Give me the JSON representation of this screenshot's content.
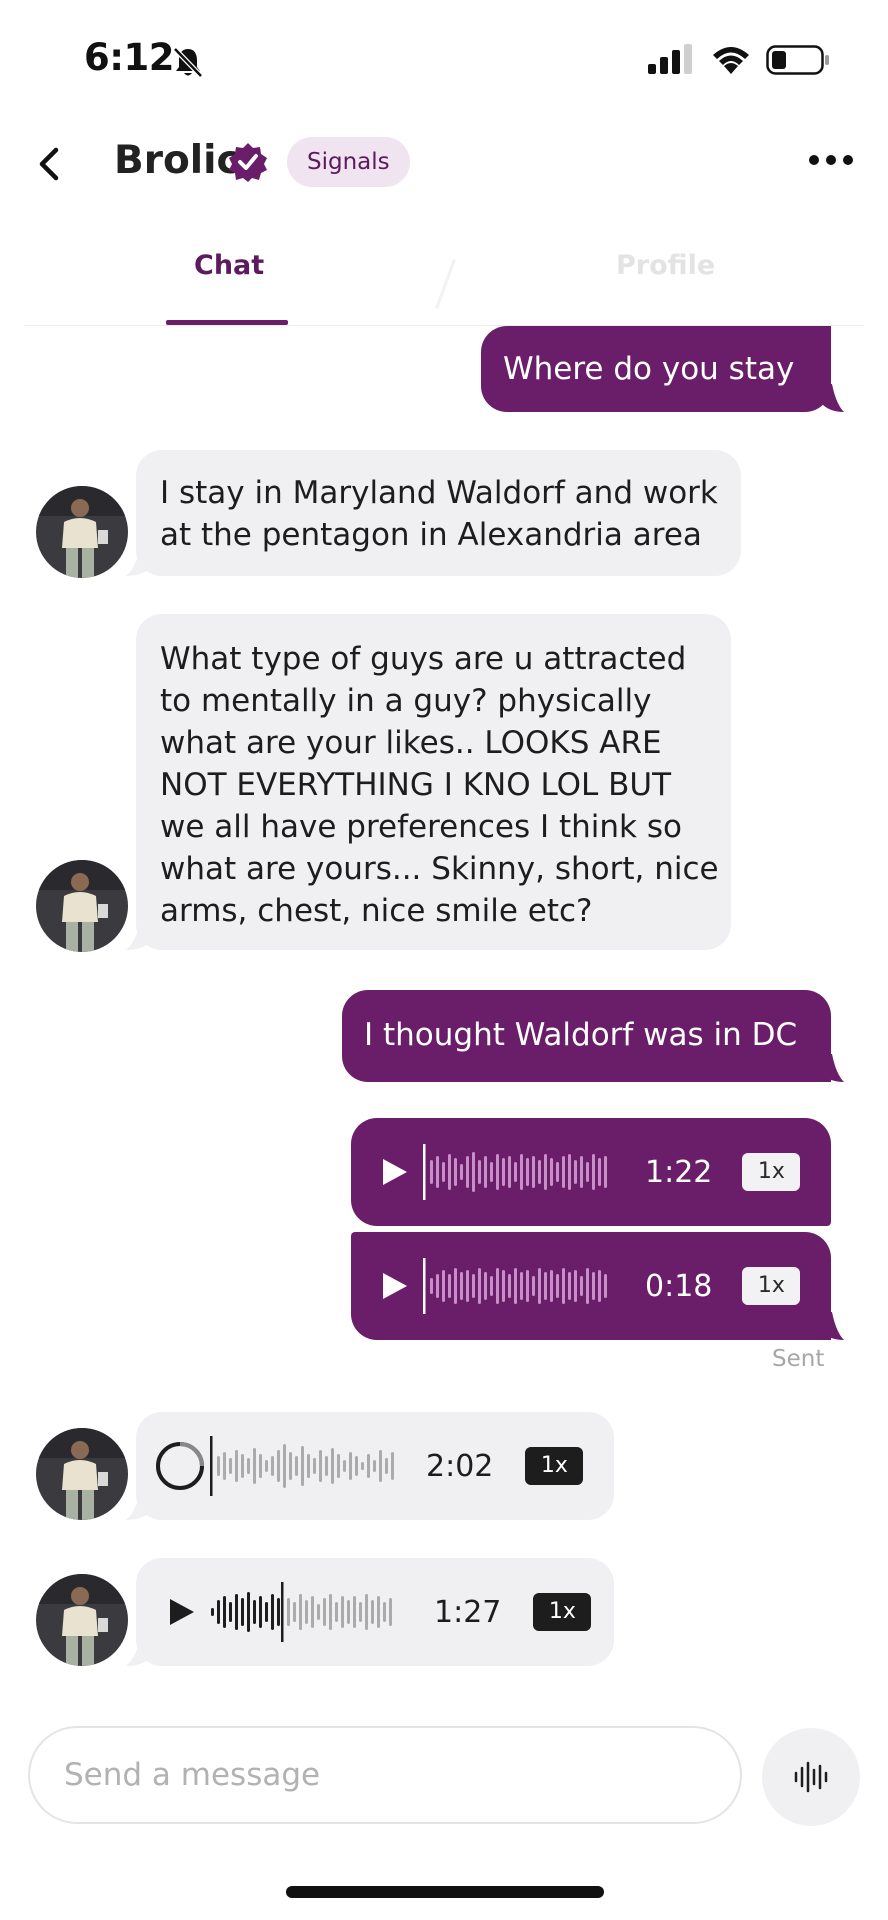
{
  "status_bar": {
    "time": "6:12",
    "icons": [
      "bell-muted-icon",
      "signal-icon",
      "wifi-icon",
      "battery-icon"
    ]
  },
  "header": {
    "back_icon": "chevron-left-icon",
    "name": "Brolic",
    "verified_icon": "verified-badge-icon",
    "badge": "Signals",
    "more_icon": "more-horizontal-icon"
  },
  "tabs": [
    {
      "label": "Chat",
      "active": true
    },
    {
      "label": "Profile",
      "active": false
    }
  ],
  "messages": {
    "m1": {
      "from": "me",
      "text": "Where do you stay"
    },
    "m2": {
      "from": "them",
      "lines": [
        "I stay in Maryland Waldorf and work",
        "at the pentagon in Alexandria area"
      ]
    },
    "m3": {
      "from": "them",
      "lines": [
        "What type of guys are u attracted",
        "to mentally in a guy? physically",
        "what are your likes.. LOOKS ARE",
        "NOT EVERYTHING I KNO LOL  BUT",
        "we all have preferences I think so",
        "what are yours... Skinny, short, nice",
        "arms, chest, nice smile etc?"
      ]
    },
    "m4": {
      "from": "me",
      "text": "I thought Waldorf was in DC"
    },
    "v1": {
      "from": "me",
      "duration": "1:22",
      "speed": "1x",
      "progress": 0
    },
    "v2": {
      "from": "me",
      "duration": "0:18",
      "speed": "1x",
      "progress": 0
    },
    "sent_label": "Sent",
    "v3": {
      "from": "them",
      "duration": "2:02",
      "speed": "1x",
      "progress": 0,
      "state": "loading"
    },
    "v4": {
      "from": "them",
      "duration": "1:27",
      "speed": "1x",
      "progress": 0.38,
      "state": "paused"
    }
  },
  "composer": {
    "placeholder": "Send a message",
    "mic_icon": "voice-waveform-icon"
  },
  "colors": {
    "accent": "#6a1e6a",
    "incoming_bubble": "#f0eff2",
    "badge_bg": "#efe4ef"
  }
}
